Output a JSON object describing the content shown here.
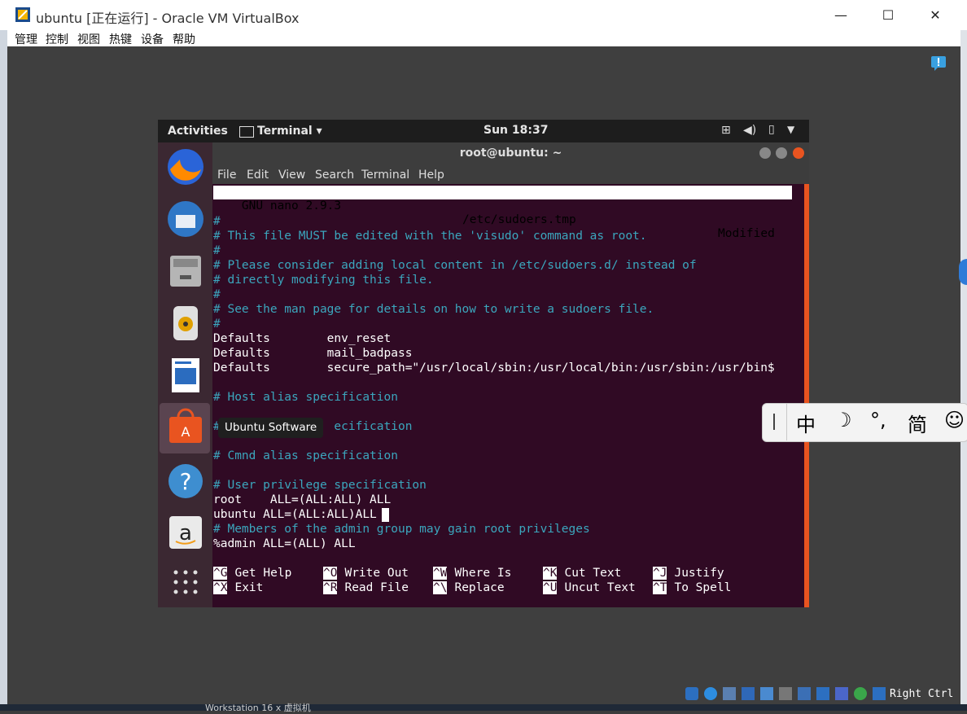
{
  "window": {
    "title": "ubuntu [正在运行] - Oracle VM VirtualBox",
    "controls": [
      "—",
      "☐",
      "✕"
    ]
  },
  "vbox_menu": [
    "管理",
    "控制",
    "视图",
    "热键",
    "设备",
    "帮助"
  ],
  "gnome_topbar": {
    "activities": "Activities",
    "app_menu": "Terminal ▾",
    "clock": "Sun 18:37"
  },
  "terminal": {
    "title": "root@ubuntu: ~",
    "menu": [
      "File",
      "Edit",
      "View",
      "Search",
      "Terminal",
      "Help"
    ]
  },
  "nano": {
    "version": "  GNU nano 2.9.3",
    "filename": "/etc/sudoers.tmp",
    "status": "Modified",
    "lines": [
      {
        "text": "#",
        "comment": true
      },
      {
        "text": "# This file MUST be edited with the 'visudo' command as root.",
        "comment": true
      },
      {
        "text": "#",
        "comment": true
      },
      {
        "text": "# Please consider adding local content in /etc/sudoers.d/ instead of",
        "comment": true
      },
      {
        "text": "# directly modifying this file.",
        "comment": true
      },
      {
        "text": "#",
        "comment": true
      },
      {
        "text": "# See the man page for details on how to write a sudoers file.",
        "comment": true
      },
      {
        "text": "#",
        "comment": true
      },
      {
        "text": "Defaults        env_reset",
        "comment": false
      },
      {
        "text": "Defaults        mail_badpass",
        "comment": false
      },
      {
        "text": "Defaults        secure_path=\"/usr/local/sbin:/usr/local/bin:/usr/sbin:/usr/bin$",
        "comment": false
      },
      {
        "text": "",
        "comment": false
      },
      {
        "text": "# Host alias specification",
        "comment": true
      },
      {
        "text": "",
        "comment": false
      },
      {
        "text": "#                ecification",
        "comment": true
      },
      {
        "text": "",
        "comment": false
      },
      {
        "text": "# Cmnd alias specification",
        "comment": true
      },
      {
        "text": "",
        "comment": false
      },
      {
        "text": "# User privilege specification",
        "comment": true
      },
      {
        "text": "root    ALL=(ALL:ALL) ALL",
        "comment": false
      },
      {
        "text": "ubuntu ALL=(ALL:ALL)ALL",
        "comment": false
      },
      {
        "text": "# Members of the admin group may gain root privileges",
        "comment": true
      },
      {
        "text": "%admin ALL=(ALL) ALL",
        "comment": false
      }
    ],
    "shortcuts_row1": [
      {
        "key": "^G",
        "label": "Get Help"
      },
      {
        "key": "^O",
        "label": "Write Out"
      },
      {
        "key": "^W",
        "label": "Where Is"
      },
      {
        "key": "^K",
        "label": "Cut Text"
      },
      {
        "key": "^J",
        "label": "Justify"
      }
    ],
    "shortcuts_row2": [
      {
        "key": "^X",
        "label": "Exit"
      },
      {
        "key": "^R",
        "label": "Read File"
      },
      {
        "key": "^\\",
        "label": "Replace"
      },
      {
        "key": "^U",
        "label": "Uncut Text"
      },
      {
        "key": "^T",
        "label": "To Spell"
      }
    ]
  },
  "dock_tooltip": "Ubuntu Software",
  "ime_bar": [
    "中",
    "☽",
    "°,",
    "简",
    "☺"
  ],
  "host_key": "Right Ctrl",
  "bottom_taskbar_text": "Workstation 16 x 虚拟机",
  "colors": {
    "terminal_bg": "#300a24",
    "comment": "#3ba6bd",
    "accent": "#e95420"
  }
}
